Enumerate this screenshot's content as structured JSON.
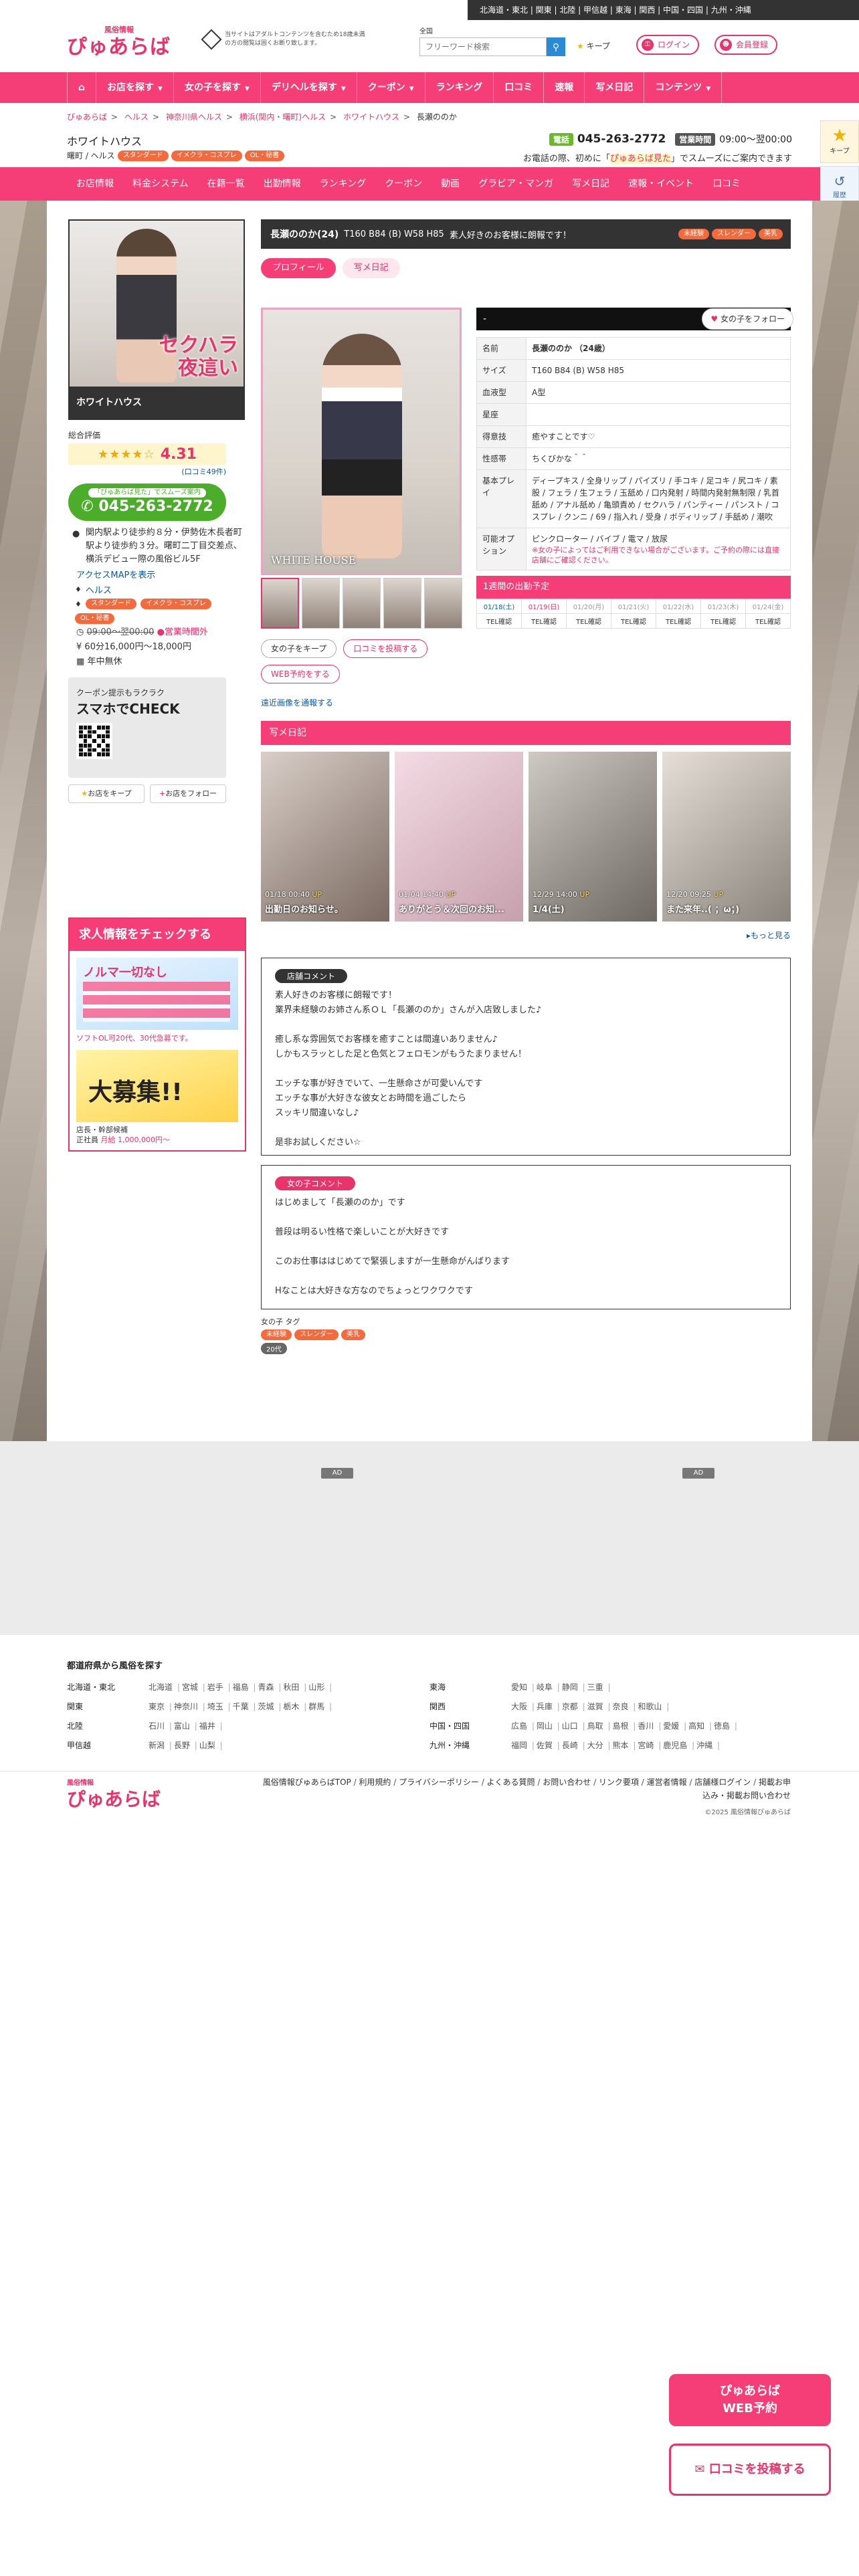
{
  "regions_bar": "北海道・東北 | 関東 | 北陸 | 甲信越 | 東海 | 関西 | 中国・四国 | 九州・沖縄",
  "header": {
    "logo_small": "風俗情報",
    "logo_main": "ぴゅあらば",
    "notice": "当サイトはアダルトコンテンツを含むため18歳未満の方の閲覧は固くお断り致します。",
    "search_label": "全国",
    "search_placeholder": "フリーワード検索",
    "keep_label": "キープ",
    "login_label": "ログイン",
    "register_label": "会員登録"
  },
  "nav": {
    "items": [
      "お店を探す",
      "女の子を探す",
      "デリヘルを探す",
      "クーポン",
      "ランキング",
      "口コミ",
      "速報",
      "写メ日記",
      "コンテンツ"
    ]
  },
  "breadcrumb": [
    "ぴゅあらば",
    "ヘルス",
    "神奈川県ヘルス",
    "横浜(関内・曙町)ヘルス",
    "ホワイトハウス",
    "長瀬ののか"
  ],
  "shop": {
    "name": "ホワイトハウス",
    "area": "曙町 / ヘルス",
    "tags": [
      "スタンダード",
      "イメクラ・コスプレ",
      "OL・秘書"
    ],
    "phone_label": "電話",
    "phone": "045-263-2772",
    "hours_label": "営業時間",
    "hours": "09:00〜翌00:00",
    "call_note_pre": "お電話の際、初めに「",
    "call_note_em": "ぴゅあらば見た",
    "call_note_post": "」でスムーズにご案内できます"
  },
  "shop_tabs": [
    "お店情報",
    "料金システム",
    "在籍一覧",
    "出勤情報",
    "ランキング",
    "クーポン",
    "動画",
    "グラビア・マンガ",
    "写メ日記",
    "速報・イベント",
    "口コミ"
  ],
  "side_float": {
    "keep": "キープ",
    "history": "履歴"
  },
  "left": {
    "banner_catch1": "セクハラ",
    "banner_catch2": "夜這い",
    "banner_name": "ホワイトハウス",
    "rating_label": "総合評価",
    "rating_value": "4.31",
    "rating_count": "(口コミ49件)",
    "tel_note": "「ぴゅあらば見た」でスムーズ案内",
    "tel": "045-263-2772",
    "address": "関内駅より徒歩約８分・伊勢佐木長者町駅より徒歩約３分。曙町二丁目交差点、横浜デビュー際の風俗ビル5F",
    "access_link": "アクセスMAPを表示",
    "genre": "ヘルス",
    "tags": [
      "スタンダード",
      "イメクラ・コスプレ",
      "OL・秘書"
    ],
    "hours_old": "09:00〜翌00:00",
    "hours_note": "営業時間外",
    "price": "60分16,000円〜18,000円",
    "holiday": "年中無休",
    "qr_note": "クーポン提示もラクラク",
    "qr_title": "スマホでCHECK",
    "keep_btn": "お店をキープ",
    "follow_btn": "お店をフォロー"
  },
  "jobs": {
    "title": "求人情報をチェックする",
    "cap1": "ソフトOL可20代、30代急募です。",
    "cap2": "店長・幹部候補",
    "cap3_pre": "正社員 ",
    "cap3": "月給 1,000,000円〜",
    "banner1": "ノルマ一切なし",
    "banner2": "大募集!!"
  },
  "girl": {
    "headline_name": "長瀬ののか(24)",
    "headline_size": "T160 B84 (B) W58 H85",
    "headline_catch": "素人好きのお客様に朗報です！",
    "headline_tags": [
      "未経験",
      "スレンダー",
      "美乳"
    ],
    "tab_profile": "プロフィール",
    "tab_diary": "写メ日記",
    "watermark": "WHITE HOUSE",
    "name_bar": "-",
    "follow": "女の子をフォロー",
    "actions": [
      "女の子をキープ",
      "口コミを投稿する",
      "WEB予約をする"
    ],
    "view_link": "遠近画像を通報する"
  },
  "profile": [
    {
      "k": "名前",
      "v": "長瀬ののか （24歳）"
    },
    {
      "k": "サイズ",
      "v": "T160 B84 (B) W58 H85"
    },
    {
      "k": "血液型",
      "v": "A型"
    },
    {
      "k": "星座",
      "v": ""
    },
    {
      "k": "得意技",
      "v": "癒やすことです♡"
    },
    {
      "k": "性感帯",
      "v": "ちくびかな＾＾"
    },
    {
      "k": "基本プレイ",
      "v": "ディープキス / 全身リップ / パイズリ / 手コキ / 足コキ / 尻コキ / 素股 / フェラ / 生フェラ / 玉舐め / 口内発射 / 時間内発射無制限 / 乳首舐め / アナル舐め / 亀頭責め / セクハラ / パンティー / パンスト / コスプレ / クンニ / 69 / 指入れ / 受身 / ボディリップ / 手舐め / 潮吹"
    },
    {
      "k": "可能オプション",
      "v": "ピンクローター / バイブ / 電マ / 放尿"
    }
  ],
  "profile_note": "※女の子によってはご利用できない場合がございます。ご予約の際には直接店舗にご確認ください。",
  "schedule": {
    "title": "1週間の出勤予定",
    "days": [
      "01/18(土)",
      "01/19(日)",
      "01/20(月)",
      "01/21(火)",
      "01/22(水)",
      "01/23(木)",
      "01/24(金)"
    ],
    "values": [
      "TEL確認",
      "TEL確認",
      "TEL確認",
      "TEL確認",
      "TEL確認",
      "TEL確認",
      "TEL確認"
    ]
  },
  "diary": {
    "title": "写メ日記",
    "cards": [
      {
        "date": "01/18 00:40",
        "up": "UP",
        "title": "出勤日のお知らせ。"
      },
      {
        "date": "01/04 14:40",
        "up": "UP",
        "title": "ありがとう＆次回のお知..."
      },
      {
        "date": "12/29 14:00",
        "up": "UP",
        "title": "1/4(土)"
      },
      {
        "date": "12/20 09:25",
        "up": "UP",
        "title": "また来年..( ；ω；)"
      }
    ],
    "more": "もっと見る"
  },
  "shop_comment": {
    "title": "店舗コメント",
    "body": "素人好きのお客様に朗報です！\n業界未経験のお姉さん系ＯＬ「長瀬ののか」さんが入店致しました♪\n\n癒し系な雰囲気でお客様を癒すことは間違いありません♪\nしかもスラッとした足と色気とフェロモンがもうたまりません！\n\nエッチな事が好きでいて、一生懸命さが可愛いんです\nエッチな事が大好きな彼女とお時間を過ごしたら\nスッキリ間違いなし♪\n\n是非お試しください☆"
  },
  "girl_comment": {
    "title": "女の子コメント",
    "body": "はじめまして「長瀬ののか」です\n\n普段は明るい性格で楽しいことが大好きです\n\nこのお仕事ははじめてで緊張しますが一生懸命がんばります\n\nHなことは大好きな方なのでちょっとワクワクです"
  },
  "girl_tags": {
    "label": "女の子 タグ",
    "row1": [
      "未経験",
      "スレンダー",
      "美乳"
    ],
    "row2": [
      "20代"
    ]
  },
  "ads": [
    "AD",
    "AD"
  ],
  "areas": {
    "title": "都道府県から風俗を探す",
    "left": [
      {
        "k": "北海道・東北",
        "v": [
          "北海道",
          "宮城",
          "岩手",
          "福島",
          "青森",
          "秋田",
          "山形"
        ]
      },
      {
        "k": "関東",
        "v": [
          "東京",
          "神奈川",
          "埼玉",
          "千葉",
          "茨城",
          "栃木",
          "群馬"
        ]
      },
      {
        "k": "北陸",
        "v": [
          "石川",
          "富山",
          "福井"
        ]
      },
      {
        "k": "甲信越",
        "v": [
          "新潟",
          "長野",
          "山梨"
        ]
      }
    ],
    "right": [
      {
        "k": "東海",
        "v": [
          "愛知",
          "岐阜",
          "静岡",
          "三重"
        ]
      },
      {
        "k": "関西",
        "v": [
          "大阪",
          "兵庫",
          "京都",
          "滋賀",
          "奈良",
          "和歌山"
        ]
      },
      {
        "k": "中国・四国",
        "v": [
          "広島",
          "岡山",
          "山口",
          "鳥取",
          "島根",
          "香川",
          "愛媛",
          "高知",
          "徳島"
        ]
      },
      {
        "k": "九州・沖縄",
        "v": [
          "福岡",
          "佐賀",
          "長崎",
          "大分",
          "熊本",
          "宮崎",
          "鹿児島",
          "沖縄"
        ]
      }
    ]
  },
  "footer": {
    "logo_small": "風俗情報",
    "logo_main": "ぴゅあらば",
    "links": [
      "風俗情報ぴゅあらばTOP",
      "利用規約",
      "プライバシーポリシー",
      "よくある質問",
      "お問い合わせ",
      "リンク要項",
      "運営者情報",
      "店舗様ログイン",
      "掲載お申込み・掲載お問い合わせ"
    ],
    "copyright": "©2025 風俗情報ぴゅあらば"
  },
  "bottom_buttons": {
    "web_reserve_1": "ぴゅあらば",
    "web_reserve_2": "WEB予約",
    "review": "口コミを投稿する"
  },
  "colors": {
    "brand": "#f53d77",
    "accent_green": "#4cad2b",
    "dark": "#333333"
  }
}
